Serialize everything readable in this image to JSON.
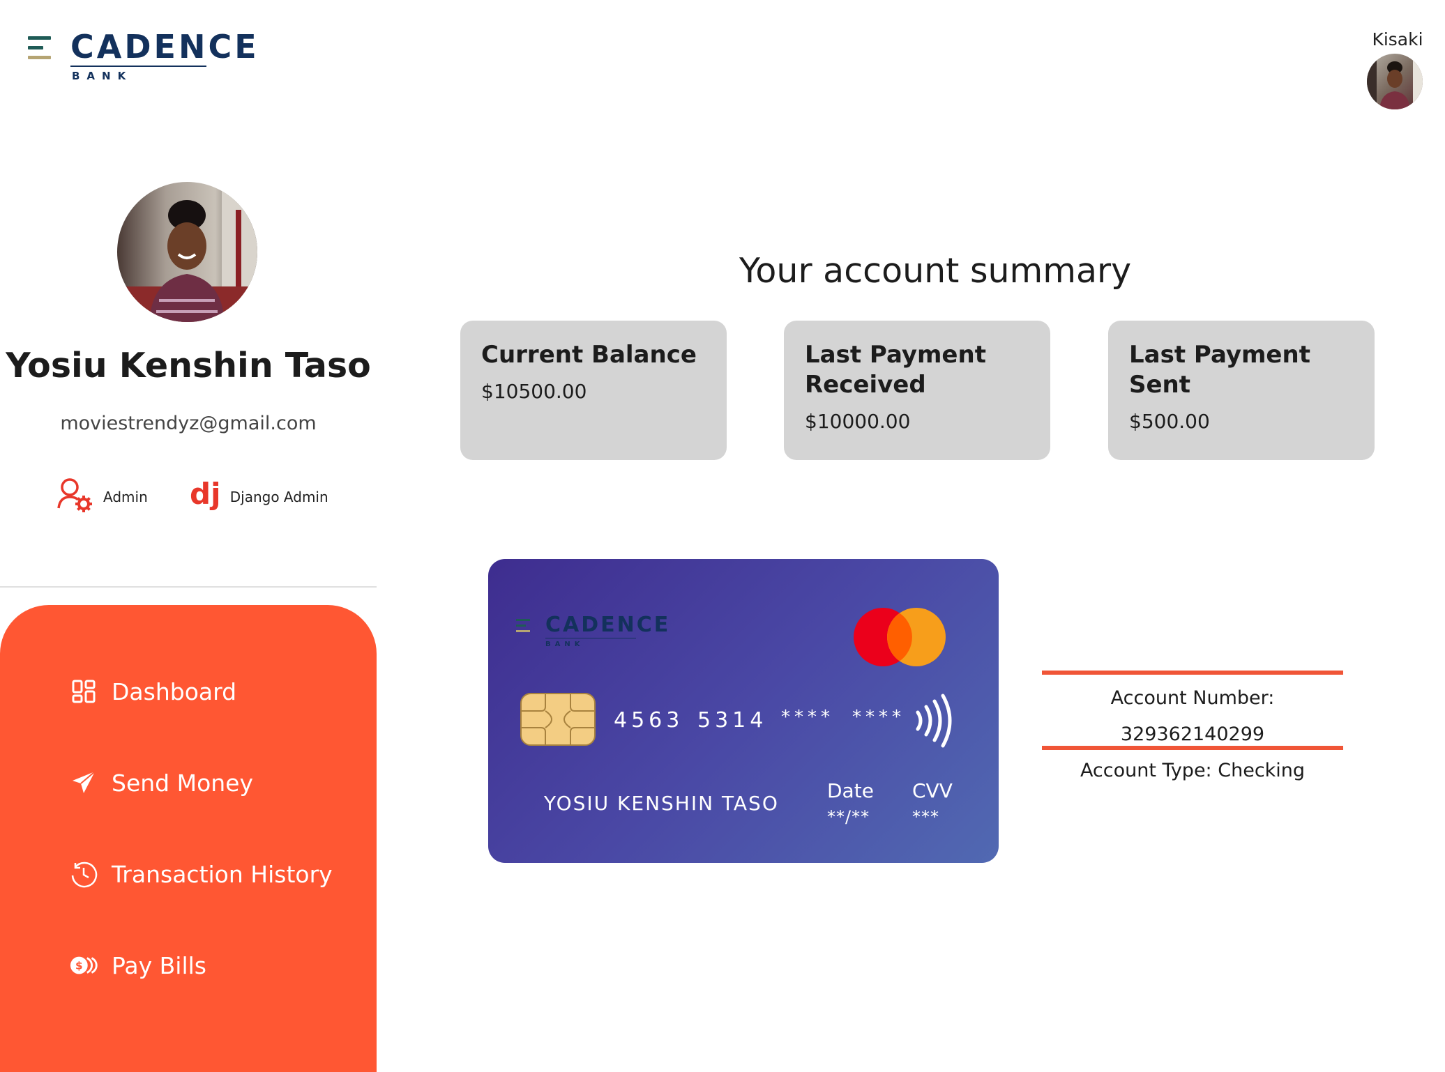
{
  "brand": {
    "name": "CADENCE",
    "sub": "BANK"
  },
  "top_user": {
    "name": "Kisaki"
  },
  "profile": {
    "name": "Yosiu Kenshin Taso",
    "email": "moviestrendyz@gmail.com",
    "links": [
      {
        "label": "Admin",
        "icon": "user-gear-icon"
      },
      {
        "label": "Django Admin",
        "icon": "django-icon"
      }
    ]
  },
  "nav": {
    "items": [
      {
        "label": "Dashboard",
        "icon": "dashboard-grid-icon"
      },
      {
        "label": "Send Money",
        "icon": "paper-plane-icon"
      },
      {
        "label": "Transaction History",
        "icon": "clock-history-icon"
      },
      {
        "label": "Pay Bills",
        "icon": "coins-icon"
      }
    ]
  },
  "summary": {
    "title": "Your account summary",
    "cards": [
      {
        "title": "Current Balance",
        "value": "$10500.00"
      },
      {
        "title": "Last Payment Received",
        "value": "$10000.00"
      },
      {
        "title": "Last Payment Sent",
        "value": "$500.00"
      }
    ]
  },
  "credit_card": {
    "brand": "CADENCE",
    "brand_sub": "BANK",
    "number_groups": [
      "4563",
      "5314",
      "****",
      "****"
    ],
    "holder": "YOSIU KENSHIN TASO",
    "date_label": "Date",
    "date_value": "**/**",
    "cvv_label": "CVV",
    "cvv_value": "***"
  },
  "account": {
    "number_label": "Account Number:",
    "number_value": "329362140299",
    "type_label": "Account Type:",
    "type_value": "Checking"
  },
  "colors": {
    "accent": "#ff5733",
    "brand_navy": "#13315c",
    "card_gray": "#d4d4d4",
    "card_gradient_start": "#3e2d8f",
    "card_gradient_end": "#5169b2"
  }
}
